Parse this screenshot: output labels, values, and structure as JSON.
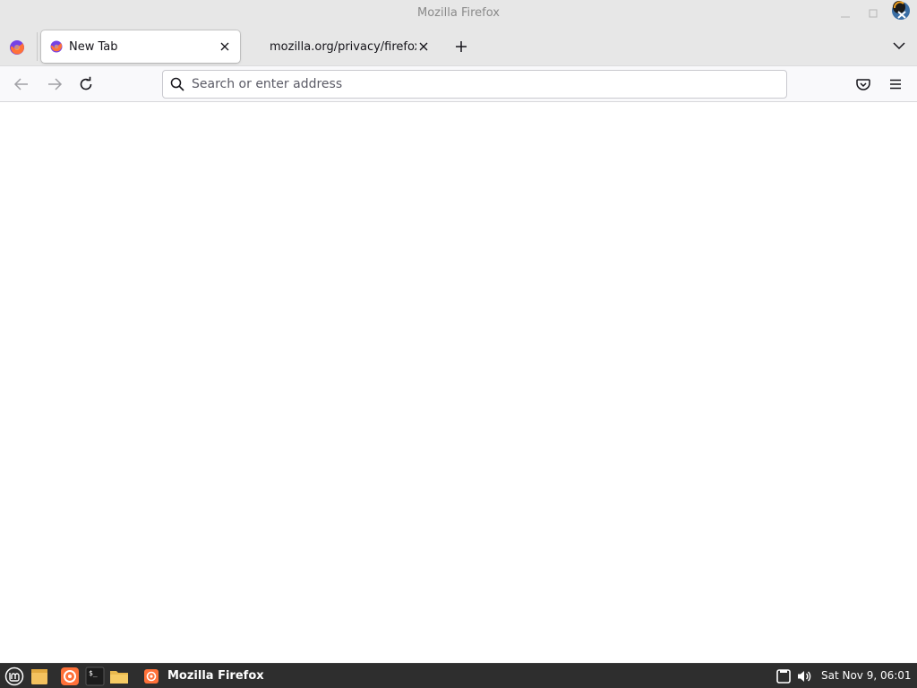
{
  "window": {
    "title": "Mozilla Firefox"
  },
  "tabs": [
    {
      "label": "New Tab",
      "active": true,
      "favicon": "firefox-icon"
    },
    {
      "label": "mozilla.org/privacy/firefox/",
      "active": false,
      "favicon": "none"
    }
  ],
  "navbar": {
    "url_placeholder": "Search or enter address",
    "url_value": ""
  },
  "taskbar": {
    "task_label": "Mozilla Firefox",
    "clock": "Sat Nov  9, 06:01"
  },
  "colors": {
    "titlebar": "#e7e7e7",
    "taskbar": "#2e2e2e",
    "firefox_orange": "#ff7139"
  }
}
